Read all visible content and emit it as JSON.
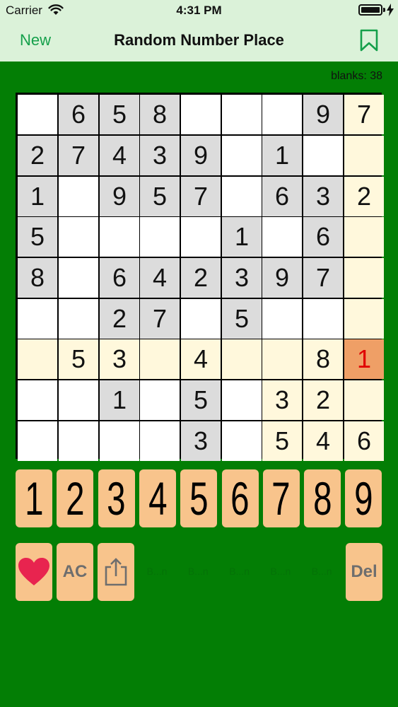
{
  "status": {
    "carrier": "Carrier",
    "time": "4:31 PM"
  },
  "nav": {
    "new_label": "New",
    "title": "Random Number Place"
  },
  "blanks_text": "blanks: 38",
  "colors": {
    "cell_white": "#ffffff",
    "cell_gray": "#dcdcdc",
    "cell_highlight": "#fff8dc",
    "cell_selected": "#ef9f66",
    "error_text": "#e00000",
    "key_bg": "#f8c48c",
    "board_bg": "#037e05"
  },
  "board": {
    "rows": [
      [
        "",
        "6",
        "5",
        "8",
        "",
        "",
        "",
        "9",
        "7"
      ],
      [
        "2",
        "7",
        "4",
        "3",
        "9",
        "",
        "1",
        "",
        ""
      ],
      [
        "1",
        "",
        "9",
        "5",
        "7",
        "",
        "6",
        "3",
        "2"
      ],
      [
        "5",
        "",
        "",
        "",
        "",
        "1",
        "",
        "6",
        ""
      ],
      [
        "8",
        "",
        "6",
        "4",
        "2",
        "3",
        "9",
        "7",
        ""
      ],
      [
        "",
        "",
        "2",
        "7",
        "",
        "5",
        "",
        "",
        ""
      ],
      [
        "",
        "5",
        "3",
        "",
        "4",
        "",
        "",
        "8",
        "1"
      ],
      [
        "",
        "",
        "1",
        "",
        "5",
        "",
        "3",
        "2",
        ""
      ],
      [
        "",
        "",
        "",
        "",
        "3",
        "",
        "5",
        "4",
        "6"
      ]
    ],
    "shading": [
      [
        "w",
        "g",
        "g",
        "g",
        "w",
        "w",
        "w",
        "g",
        "h"
      ],
      [
        "g",
        "g",
        "g",
        "g",
        "g",
        "w",
        "g",
        "w",
        "h"
      ],
      [
        "g",
        "w",
        "g",
        "g",
        "g",
        "w",
        "g",
        "g",
        "h"
      ],
      [
        "g",
        "w",
        "w",
        "w",
        "w",
        "g",
        "w",
        "g",
        "h"
      ],
      [
        "g",
        "w",
        "g",
        "g",
        "g",
        "g",
        "g",
        "g",
        "h"
      ],
      [
        "w",
        "w",
        "g",
        "g",
        "w",
        "g",
        "w",
        "w",
        "h"
      ],
      [
        "h",
        "h",
        "h",
        "h",
        "h",
        "h",
        "h",
        "h",
        "s"
      ],
      [
        "w",
        "w",
        "g",
        "w",
        "g",
        "w",
        "h",
        "h",
        "h"
      ],
      [
        "w",
        "w",
        "w",
        "w",
        "g",
        "w",
        "h",
        "h",
        "h"
      ]
    ],
    "selected_value": "1"
  },
  "keypad": [
    "1",
    "2",
    "3",
    "4",
    "5",
    "6",
    "7",
    "8",
    "9"
  ],
  "actions": {
    "favorite_icon": "heart-icon",
    "clear_label": "AC",
    "share_icon": "share-icon",
    "delete_label": "Del"
  },
  "slots": [
    "B...n",
    "B...n",
    "B...n",
    "B...n",
    "B...n"
  ]
}
